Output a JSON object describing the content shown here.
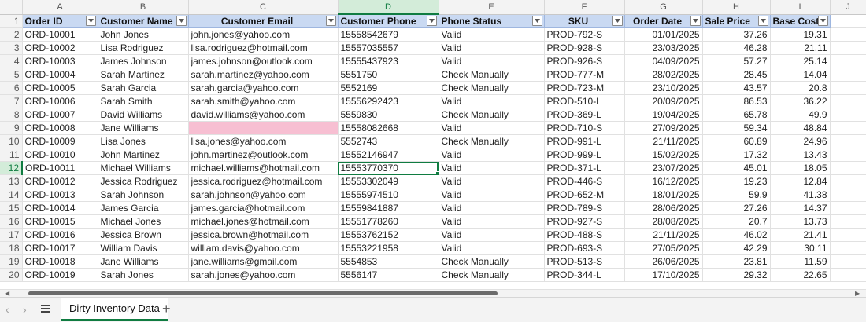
{
  "columns": [
    "A",
    "B",
    "C",
    "D",
    "E",
    "F",
    "G",
    "H",
    "I",
    "J"
  ],
  "active_column": "D",
  "active_row": 12,
  "header_row": {
    "row": 1,
    "cells": [
      "Order ID",
      "Customer Name",
      "Customer Email",
      "Customer Phone",
      "Phone Status",
      "SKU",
      "Order Date",
      "Sale Price",
      "Base Cost"
    ]
  },
  "rows": [
    {
      "row": 2,
      "cells": [
        "ORD-10001",
        "John Jones",
        "john.jones@yahoo.com",
        "15558542679",
        "Valid",
        "PROD-792-S",
        "01/01/2025",
        "37.26",
        "19.31"
      ]
    },
    {
      "row": 3,
      "cells": [
        "ORD-10002",
        "Lisa Rodriguez",
        "lisa.rodriguez@hotmail.com",
        "15557035557",
        "Valid",
        "PROD-928-S",
        "23/03/2025",
        "46.28",
        "21.11"
      ]
    },
    {
      "row": 4,
      "cells": [
        "ORD-10003",
        "James Johnson",
        "james.johnson@outlook.com",
        "15555437923",
        "Valid",
        "PROD-926-S",
        "04/09/2025",
        "57.27",
        "25.14"
      ]
    },
    {
      "row": 5,
      "cells": [
        "ORD-10004",
        "Sarah Martinez",
        "sarah.martinez@yahoo.com",
        "5551750",
        "Check Manually",
        "PROD-777-M",
        "28/02/2025",
        "28.45",
        "14.04"
      ]
    },
    {
      "row": 6,
      "cells": [
        "ORD-10005",
        "Sarah Garcia",
        "sarah.garcia@yahoo.com",
        "5552169",
        "Check Manually",
        "PROD-723-M",
        "23/10/2025",
        "43.57",
        "20.8"
      ]
    },
    {
      "row": 7,
      "cells": [
        "ORD-10006",
        "Sarah Smith",
        "sarah.smith@yahoo.com",
        "15556292423",
        "Valid",
        "PROD-510-L",
        "20/09/2025",
        "86.53",
        "36.22"
      ]
    },
    {
      "row": 8,
      "cells": [
        "ORD-10007",
        "David Williams",
        "david.williams@yahoo.com",
        "5559830",
        "Check Manually",
        "PROD-369-L",
        "19/04/2025",
        "65.78",
        "49.9"
      ]
    },
    {
      "row": 9,
      "cells": [
        "ORD-10008",
        "Jane Williams",
        "",
        "15558082668",
        "Valid",
        "PROD-710-S",
        "27/09/2025",
        "59.34",
        "48.84"
      ]
    },
    {
      "row": 10,
      "cells": [
        "ORD-10009",
        "Lisa Jones",
        "lisa.jones@yahoo.com",
        "5552743",
        "Check Manually",
        "PROD-991-L",
        "21/11/2025",
        "60.89",
        "24.96"
      ]
    },
    {
      "row": 11,
      "cells": [
        "ORD-10010",
        "John Martinez",
        "john.martinez@outlook.com",
        "15552146947",
        "Valid",
        "PROD-999-L",
        "15/02/2025",
        "17.32",
        "13.43"
      ]
    },
    {
      "row": 12,
      "cells": [
        "ORD-10011",
        "Michael Williams",
        "michael.williams@hotmail.com",
        "15553770370",
        "Valid",
        "PROD-371-L",
        "23/07/2025",
        "45.01",
        "18.05"
      ]
    },
    {
      "row": 13,
      "cells": [
        "ORD-10012",
        "Jessica Rodriguez",
        "jessica.rodriguez@hotmail.com",
        "15553302049",
        "Valid",
        "PROD-446-S",
        "16/12/2025",
        "19.23",
        "12.84"
      ]
    },
    {
      "row": 14,
      "cells": [
        "ORD-10013",
        "Sarah Johnson",
        "sarah.johnson@yahoo.com",
        "15555974510",
        "Valid",
        "PROD-652-M",
        "18/01/2025",
        "59.9",
        "41.38"
      ]
    },
    {
      "row": 15,
      "cells": [
        "ORD-10014",
        "James Garcia",
        "james.garcia@hotmail.com",
        "15559841887",
        "Valid",
        "PROD-789-S",
        "28/06/2025",
        "27.26",
        "14.37"
      ]
    },
    {
      "row": 16,
      "cells": [
        "ORD-10015",
        "Michael Jones",
        "michael.jones@hotmail.com",
        "15551778260",
        "Valid",
        "PROD-927-S",
        "28/08/2025",
        "20.7",
        "13.73"
      ]
    },
    {
      "row": 17,
      "cells": [
        "ORD-10016",
        "Jessica Brown",
        "jessica.brown@hotmail.com",
        "15553762152",
        "Valid",
        "PROD-488-S",
        "21/11/2025",
        "46.02",
        "21.41"
      ]
    },
    {
      "row": 18,
      "cells": [
        "ORD-10017",
        "William Davis",
        "william.davis@yahoo.com",
        "15553221958",
        "Valid",
        "PROD-693-S",
        "27/05/2025",
        "42.29",
        "30.11"
      ]
    },
    {
      "row": 19,
      "cells": [
        "ORD-10018",
        "Jane Williams",
        "jane.williams@gmail.com",
        "5554853",
        "Check Manually",
        "PROD-513-S",
        "26/06/2025",
        "23.81",
        "11.59"
      ]
    },
    {
      "row": 20,
      "cells": [
        "ORD-10019",
        "Sarah Jones",
        "sarah.jones@yahoo.com",
        "5556147",
        "Check Manually",
        "PROD-344-L",
        "17/10/2025",
        "29.32",
        "22.65"
      ]
    }
  ],
  "highlight_color": "#f7bfd2",
  "sheet_tabs": {
    "prev_icon": "chevron-left-icon",
    "next_icon": "chevron-right-icon",
    "menu_icon": "hamburger-icon",
    "active_tab": "Dirty Inventory Data",
    "add_icon": "plus-icon"
  }
}
